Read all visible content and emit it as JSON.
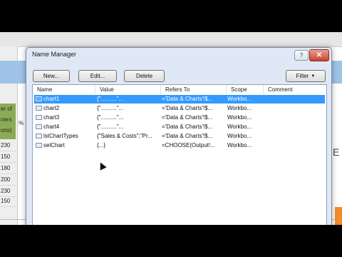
{
  "sheet": {
    "green_header_lines": [
      "er of",
      "ners",
      "ons)"
    ],
    "pct_symbol": "%",
    "numbers": [
      "230",
      "150",
      "180",
      "200",
      "230",
      "150"
    ],
    "right_edge_text": "E"
  },
  "dialog": {
    "title": "Name Manager",
    "help_label": "?",
    "close_label": "✕",
    "buttons": {
      "new": "New...",
      "edit": "Edit...",
      "delete": "Delete",
      "filter": "Filter"
    },
    "columns": [
      "Name",
      "Value",
      "Refers To",
      "Scope",
      "Comment"
    ],
    "rows": [
      {
        "name": "chart1",
        "value": "{\"..........\"...",
        "refers": "='Data & Charts'!$...",
        "scope": "Workbo..."
      },
      {
        "name": "chart2",
        "value": "{\"..........\"...",
        "refers": "='Data & Charts'!$...",
        "scope": "Workbo..."
      },
      {
        "name": "chart3",
        "value": "{\"..........\"...",
        "refers": "='Data & Charts'!$...",
        "scope": "Workbo..."
      },
      {
        "name": "chart4",
        "value": "{\"..........\"...",
        "refers": "='Data & Charts'!$...",
        "scope": "Workbo..."
      },
      {
        "name": "lstChartTypes",
        "value": "{\"Sales & Costs\";\"Pr...",
        "refers": "='Data & Charts'!$...",
        "scope": "Workbo..."
      },
      {
        "name": "selChart",
        "value": "{...}",
        "refers": "=CHOOSE(Output!...",
        "scope": "Workbo..."
      }
    ],
    "selected_row": 0
  }
}
